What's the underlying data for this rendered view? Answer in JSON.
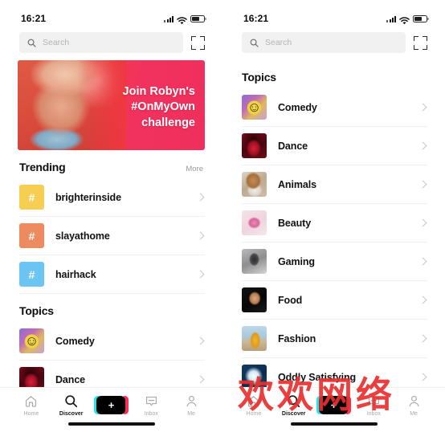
{
  "status_bar": {
    "time": "16:21",
    "icons": [
      "signal-icon",
      "wifi-icon",
      "battery-icon"
    ]
  },
  "search": {
    "placeholder": "Search",
    "icon": "search-icon",
    "scan_icon": "qr-scan-icon"
  },
  "left_panel": {
    "banner": {
      "line1": "Join Robyn's",
      "line2": "#OnMyOwn",
      "line3": "challenge"
    },
    "trending": {
      "title": "Trending",
      "more": "More",
      "items": [
        {
          "label": "brighterinside",
          "glyph": "#",
          "color": "#F5CE52",
          "thumb_class": "th-hash-y"
        },
        {
          "label": "slayathome",
          "glyph": "#",
          "color": "#EE8A5F",
          "thumb_class": "th-hash-o"
        },
        {
          "label": "hairhack",
          "glyph": "#",
          "color": "#6CC4F2",
          "thumb_class": "th-hash-b"
        }
      ]
    },
    "topics": {
      "title": "Topics",
      "items": [
        {
          "label": "Comedy",
          "thumb_class": "th-comedy"
        },
        {
          "label": "Dance",
          "thumb_class": "th-dance"
        }
      ]
    }
  },
  "right_panel": {
    "topics": {
      "title": "Topics",
      "items": [
        {
          "label": "Comedy",
          "thumb_class": "th-comedy"
        },
        {
          "label": "Dance",
          "thumb_class": "th-dance"
        },
        {
          "label": "Animals",
          "thumb_class": "th-animals"
        },
        {
          "label": "Beauty",
          "thumb_class": "th-beauty"
        },
        {
          "label": "Gaming",
          "thumb_class": "th-gaming"
        },
        {
          "label": "Food",
          "thumb_class": "th-food"
        },
        {
          "label": "Fashion",
          "thumb_class": "th-fashion"
        },
        {
          "label": "Oddly Satisfying",
          "thumb_class": "th-oddly"
        }
      ]
    }
  },
  "tabbar": {
    "items": [
      {
        "label": "Home",
        "icon": "home-icon",
        "active": false
      },
      {
        "label": "Discover",
        "icon": "search-icon",
        "active": true
      },
      {
        "label": "",
        "icon": "create-icon",
        "active": false
      },
      {
        "label": "Inbox",
        "icon": "inbox-icon",
        "active": false
      },
      {
        "label": "Me",
        "icon": "person-icon",
        "active": false
      }
    ],
    "create_glyph": "+"
  },
  "watermark": {
    "text": "欢欢网络",
    "color": "#E8302F"
  }
}
